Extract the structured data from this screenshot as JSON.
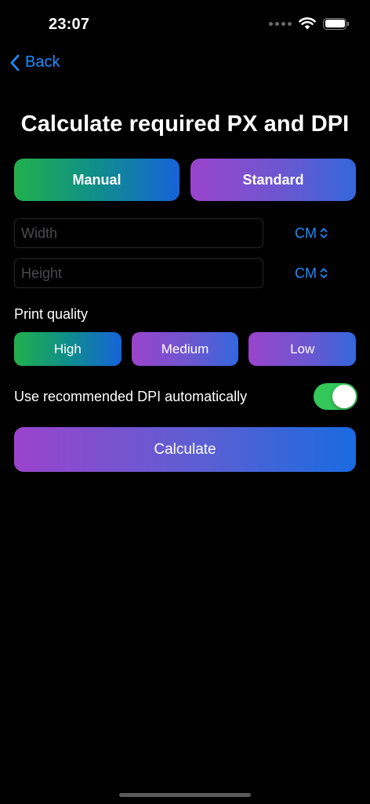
{
  "status_bar": {
    "time": "23:07"
  },
  "nav": {
    "back_label": "Back"
  },
  "page": {
    "title": "Calculate required PX and DPI"
  },
  "mode": {
    "manual_label": "Manual",
    "standard_label": "Standard"
  },
  "inputs": {
    "width": {
      "placeholder": "Width",
      "value": "",
      "unit": "CM"
    },
    "height": {
      "placeholder": "Height",
      "value": "",
      "unit": "CM"
    }
  },
  "quality": {
    "label": "Print quality",
    "options": [
      "High",
      "Medium",
      "Low"
    ],
    "selected": "High"
  },
  "auto_dpi": {
    "label": "Use recommended DPI automatically",
    "enabled": true
  },
  "actions": {
    "calculate_label": "Calculate"
  },
  "colors": {
    "accent_blue": "#1e8cff",
    "toggle_on": "#34c759",
    "background": "#000000"
  },
  "icons": {
    "back": "chevron-left-icon",
    "unit_picker": "chevron-up-down-icon",
    "wifi": "wifi-icon",
    "battery": "battery-icon",
    "signal": "cellular-signal-icon"
  }
}
